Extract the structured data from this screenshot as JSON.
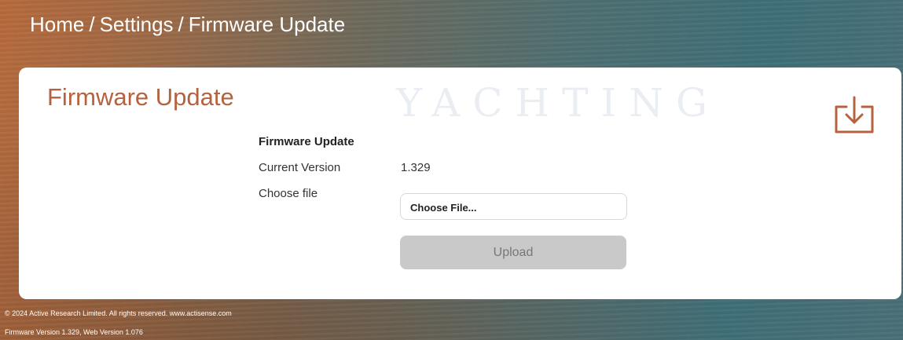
{
  "breadcrumb": {
    "home": "Home",
    "settings": "Settings",
    "current": "Firmware Update",
    "separator": "/"
  },
  "card": {
    "title": "Firmware Update",
    "watermark": "YACHTING",
    "action_icon": "download-icon",
    "section_label": "Firmware Update",
    "current_version_label": "Current Version",
    "current_version_value": "1.329",
    "choose_file_label": "Choose file",
    "file_button_label": "Choose File...",
    "upload_label": "Upload"
  },
  "footer": {
    "copyright": "© 2024 Active Research Limited. All rights reserved.  www.actisense.com",
    "version": "Firmware Version 1.329, Web Version 1.076"
  },
  "colors": {
    "accent": "#b5633e",
    "upload_disabled_bg": "#c9c9c9",
    "card_bg": "#ffffff"
  }
}
